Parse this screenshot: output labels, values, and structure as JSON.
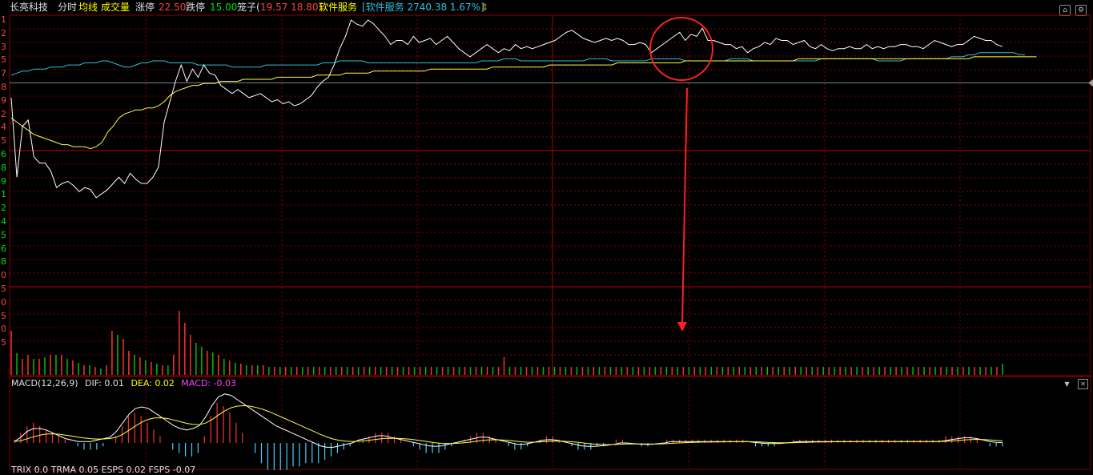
{
  "header": {
    "stock_name": "长亮科技",
    "tab_intraday": "分时",
    "avg_label": "均线",
    "volume_label": "成交量",
    "limit_up_label": "涨停",
    "limit_up": "22.50",
    "limit_down_label": "跌停",
    "limit_down": "15.00",
    "twin_label": "笼子(",
    "twin_values": "19.57 18.80)",
    "sector_label": "软件服务",
    "sector_index": "[软件服务 2740.38 1.67%]"
  },
  "left_axis": [
    "1",
    "2",
    "3",
    "5",
    "7",
    "8",
    "9",
    "2",
    "4",
    "5",
    "6",
    "8",
    "9",
    "1",
    "2",
    "4",
    "5",
    "6",
    "8",
    "0",
    "5",
    "0",
    "5",
    "0",
    "5"
  ],
  "macd": {
    "name": "MACD(12,26,9)",
    "dif": "DIF: 0.01",
    "dea": "DEA: 0.02",
    "macd": "MACD: -0.03"
  },
  "footer": "TRIX 0.0  TRMA 0.05  ESPS 0.02  FSPS -0.07",
  "colors": {
    "price": "#ffffff",
    "avg": "#ffff40",
    "index": "#30c0d0",
    "grid": "#8a0000",
    "volume_up": "#ff3030",
    "volume_down": "#00c000",
    "macd_down": "#40d0ff",
    "annotation": "#ff2020"
  },
  "chart_data": {
    "type": "line",
    "price": [
      0.62,
      0.23,
      0.48,
      0.51,
      0.33,
      0.3,
      0.3,
      0.26,
      0.18,
      0.2,
      0.21,
      0.19,
      0.16,
      0.18,
      0.17,
      0.13,
      0.15,
      0.17,
      0.2,
      0.23,
      0.2,
      0.25,
      0.22,
      0.2,
      0.2,
      0.23,
      0.28,
      0.5,
      0.6,
      0.7,
      0.78,
      0.7,
      0.76,
      0.72,
      0.78,
      0.74,
      0.73,
      0.68,
      0.66,
      0.64,
      0.66,
      0.64,
      0.62,
      0.63,
      0.64,
      0.62,
      0.6,
      0.61,
      0.59,
      0.6,
      0.58,
      0.59,
      0.61,
      0.63,
      0.67,
      0.7,
      0.72,
      0.78,
      0.86,
      0.92,
      1.0,
      0.98,
      0.97,
      1.0,
      0.98,
      0.95,
      0.92,
      0.88,
      0.9,
      0.9,
      0.88,
      0.92,
      0.89,
      0.9,
      0.91,
      0.88,
      0.9,
      0.92,
      0.89,
      0.86,
      0.84,
      0.82,
      0.84,
      0.86,
      0.88,
      0.86,
      0.84,
      0.86,
      0.85,
      0.88,
      0.86,
      0.87,
      0.86,
      0.87,
      0.88,
      0.89,
      0.9,
      0.92,
      0.94,
      0.95,
      0.93,
      0.91,
      0.9,
      0.89,
      0.9,
      0.91,
      0.9,
      0.91,
      0.9,
      0.88,
      0.88,
      0.89,
      0.88,
      0.84,
      0.86,
      0.88,
      0.9,
      0.92,
      0.94,
      0.9,
      0.93,
      0.92,
      0.96,
      0.9,
      0.9,
      0.89,
      0.88,
      0.88,
      0.86,
      0.87,
      0.84,
      0.86,
      0.87,
      0.89,
      0.88,
      0.91,
      0.9,
      0.9,
      0.88,
      0.89,
      0.9,
      0.87,
      0.86,
      0.88,
      0.86,
      0.85,
      0.86,
      0.86,
      0.87,
      0.86,
      0.86,
      0.88,
      0.86,
      0.87,
      0.86,
      0.87,
      0.87,
      0.88,
      0.88,
      0.87,
      0.87,
      0.86,
      0.88,
      0.9,
      0.89,
      0.88,
      0.87,
      0.88,
      0.88,
      0.9,
      0.92,
      0.91,
      0.9,
      0.9,
      0.88,
      0.87
    ],
    "avg": [
      0.52,
      0.5,
      0.48,
      0.46,
      0.44,
      0.43,
      0.42,
      0.41,
      0.4,
      0.39,
      0.39,
      0.38,
      0.38,
      0.38,
      0.37,
      0.38,
      0.4,
      0.45,
      0.48,
      0.52,
      0.54,
      0.55,
      0.56,
      0.56,
      0.57,
      0.57,
      0.58,
      0.6,
      0.63,
      0.65,
      0.66,
      0.67,
      0.68,
      0.68,
      0.69,
      0.69,
      0.69,
      0.7,
      0.7,
      0.7,
      0.7,
      0.71,
      0.71,
      0.71,
      0.71,
      0.71,
      0.71,
      0.72,
      0.72,
      0.72,
      0.72,
      0.72,
      0.72,
      0.72,
      0.73,
      0.73,
      0.73,
      0.73,
      0.73,
      0.74,
      0.74,
      0.74,
      0.74,
      0.74,
      0.75,
      0.75,
      0.75,
      0.75,
      0.75,
      0.75,
      0.75,
      0.75,
      0.75,
      0.75,
      0.76,
      0.76,
      0.76,
      0.76,
      0.76,
      0.76,
      0.76,
      0.76,
      0.76,
      0.76,
      0.76,
      0.77,
      0.77,
      0.77,
      0.77,
      0.77,
      0.77,
      0.77,
      0.77,
      0.77,
      0.77,
      0.78,
      0.78,
      0.78,
      0.78,
      0.78,
      0.78,
      0.78,
      0.78,
      0.78,
      0.78,
      0.78,
      0.78,
      0.79,
      0.79,
      0.79,
      0.79,
      0.79,
      0.79,
      0.79,
      0.79,
      0.79,
      0.79,
      0.79,
      0.79,
      0.8,
      0.8,
      0.8,
      0.8,
      0.8,
      0.8,
      0.8,
      0.8,
      0.8,
      0.8,
      0.8,
      0.8,
      0.8,
      0.8,
      0.8,
      0.8,
      0.8,
      0.8,
      0.8,
      0.8,
      0.81,
      0.81,
      0.81,
      0.81,
      0.81,
      0.81,
      0.81,
      0.81,
      0.81,
      0.81,
      0.81,
      0.81,
      0.81,
      0.81,
      0.81,
      0.81,
      0.81,
      0.81,
      0.81,
      0.81,
      0.81,
      0.81,
      0.81,
      0.81,
      0.81,
      0.81,
      0.81,
      0.81,
      0.81,
      0.81,
      0.81,
      0.82,
      0.82,
      0.82,
      0.82,
      0.82,
      0.82,
      0.82,
      0.82,
      0.82,
      0.82,
      0.82,
      0.82
    ],
    "index": [
      0.73,
      0.74,
      0.75,
      0.75,
      0.76,
      0.76,
      0.76,
      0.77,
      0.77,
      0.77,
      0.78,
      0.78,
      0.78,
      0.79,
      0.79,
      0.79,
      0.8,
      0.8,
      0.79,
      0.78,
      0.77,
      0.77,
      0.78,
      0.79,
      0.79,
      0.8,
      0.8,
      0.8,
      0.79,
      0.79,
      0.79,
      0.79,
      0.79,
      0.78,
      0.78,
      0.78,
      0.78,
      0.78,
      0.78,
      0.77,
      0.77,
      0.77,
      0.77,
      0.77,
      0.77,
      0.78,
      0.78,
      0.78,
      0.78,
      0.78,
      0.78,
      0.78,
      0.78,
      0.78,
      0.78,
      0.79,
      0.79,
      0.79,
      0.8,
      0.8,
      0.8,
      0.8,
      0.8,
      0.79,
      0.79,
      0.79,
      0.79,
      0.79,
      0.79,
      0.79,
      0.79,
      0.79,
      0.79,
      0.79,
      0.79,
      0.79,
      0.79,
      0.79,
      0.79,
      0.79,
      0.79,
      0.79,
      0.79,
      0.8,
      0.8,
      0.8,
      0.8,
      0.81,
      0.81,
      0.81,
      0.8,
      0.8,
      0.8,
      0.8,
      0.8,
      0.8,
      0.8,
      0.8,
      0.8,
      0.8,
      0.8,
      0.8,
      0.81,
      0.81,
      0.81,
      0.81,
      0.8,
      0.8,
      0.8,
      0.8,
      0.8,
      0.8,
      0.8,
      0.81,
      0.81,
      0.81,
      0.81,
      0.81,
      0.81,
      0.8,
      0.8,
      0.8,
      0.8,
      0.8,
      0.8,
      0.8,
      0.8,
      0.81,
      0.81,
      0.81,
      0.81,
      0.8,
      0.8,
      0.8,
      0.8,
      0.8,
      0.8,
      0.8,
      0.8,
      0.8,
      0.8,
      0.8,
      0.8,
      0.81,
      0.81,
      0.81,
      0.81,
      0.81,
      0.81,
      0.81,
      0.81,
      0.81,
      0.81,
      0.8,
      0.8,
      0.8,
      0.8,
      0.8,
      0.81,
      0.81,
      0.81,
      0.81,
      0.81,
      0.81,
      0.81,
      0.81,
      0.82,
      0.82,
      0.82,
      0.83,
      0.83,
      0.84,
      0.84,
      0.84,
      0.84,
      0.84,
      0.84,
      0.84,
      0.83,
      0.83
    ],
    "volume": [
      0.55,
      0.27,
      0.2,
      0.25,
      0.2,
      0.2,
      0.22,
      0.25,
      0.25,
      0.25,
      0.2,
      0.18,
      0.15,
      0.12,
      0.12,
      0.1,
      0.08,
      0.12,
      0.55,
      0.5,
      0.45,
      0.3,
      0.25,
      0.22,
      0.18,
      0.16,
      0.14,
      0.12,
      0.12,
      0.25,
      0.8,
      0.65,
      0.5,
      0.4,
      0.35,
      0.3,
      0.28,
      0.25,
      0.2,
      0.18,
      0.15,
      0.14,
      0.12,
      0.12,
      0.12,
      0.12,
      0.1,
      0.1,
      0.1,
      0.1,
      0.1,
      0.1,
      0.1,
      0.1,
      0.1,
      0.1,
      0.1,
      0.1,
      0.1,
      0.1,
      0.1,
      0.1,
      0.1,
      0.1,
      0.1,
      0.1,
      0.1,
      0.1,
      0.1,
      0.1,
      0.1,
      0.1,
      0.1,
      0.1,
      0.1,
      0.1,
      0.1,
      0.1,
      0.1,
      0.1,
      0.1,
      0.1,
      0.1,
      0.1,
      0.1,
      0.1,
      0.1,
      0.1,
      0.22,
      0.1,
      0.1,
      0.1,
      0.1,
      0.1,
      0.1,
      0.1,
      0.1,
      0.1,
      0.1,
      0.1,
      0.1,
      0.1,
      0.1,
      0.1,
      0.1,
      0.1,
      0.1,
      0.1,
      0.1,
      0.1,
      0.1,
      0.1,
      0.1,
      0.1,
      0.1,
      0.1,
      0.1,
      0.1,
      0.1,
      0.1,
      0.1,
      0.1,
      0.1,
      0.1,
      0.1,
      0.1,
      0.1,
      0.1,
      0.1,
      0.1,
      0.1,
      0.1,
      0.1,
      0.1,
      0.1,
      0.1,
      0.1,
      0.1,
      0.1,
      0.1,
      0.1,
      0.1,
      0.1,
      0.1,
      0.1,
      0.1,
      0.1,
      0.1,
      0.1,
      0.1,
      0.1,
      0.1,
      0.1,
      0.1,
      0.1,
      0.1,
      0.1,
      0.1,
      0.1,
      0.1,
      0.1,
      0.1,
      0.1,
      0.1,
      0.1,
      0.1,
      0.1,
      0.1,
      0.1,
      0.1,
      0.1,
      0.1,
      0.1,
      0.1,
      0.1,
      0.1,
      0.1,
      0.14
    ],
    "volume_up": [
      1,
      0,
      1,
      1,
      0,
      1,
      0,
      1,
      0,
      1,
      0,
      1,
      0,
      1,
      0,
      1,
      0,
      1,
      1,
      0,
      1,
      1,
      0,
      1,
      0,
      1,
      0,
      1,
      0,
      1,
      1,
      1,
      1,
      0,
      0,
      1,
      0,
      1,
      0,
      1,
      0,
      1,
      0,
      1,
      0,
      1,
      0,
      1,
      0,
      1,
      0,
      1,
      0,
      1,
      0,
      1,
      0,
      1,
      0,
      1,
      0,
      1,
      0,
      1,
      0,
      1,
      0,
      1,
      0,
      1,
      0,
      1,
      0,
      1,
      0,
      1,
      0,
      1,
      0,
      1,
      0,
      1,
      0,
      1,
      0,
      1,
      0,
      1,
      1,
      0,
      1,
      0,
      1,
      0,
      1,
      0,
      1,
      0,
      1,
      0,
      1,
      0,
      1,
      0,
      1,
      0,
      1,
      0,
      1,
      0,
      1,
      0,
      1,
      0,
      1,
      0,
      1,
      0,
      1,
      0,
      1,
      0,
      1,
      0,
      1,
      0,
      1,
      0,
      1,
      0,
      1,
      0,
      1,
      0,
      1,
      0,
      1,
      0,
      1,
      0,
      1,
      0,
      1,
      0,
      1,
      0,
      1,
      0,
      1,
      0,
      1,
      0,
      1,
      0,
      1,
      0,
      1,
      0,
      1,
      0,
      1,
      0,
      1,
      0,
      1,
      0,
      1,
      0,
      1,
      0,
      1,
      0,
      1,
      0,
      1,
      0,
      1,
      0,
      1,
      0
    ],
    "macd_hist": [
      0.1,
      0.3,
      0.5,
      0.6,
      0.5,
      0.4,
      0.3,
      0.2,
      0.1,
      0.0,
      -0.1,
      -0.2,
      -0.2,
      -0.2,
      -0.1,
      0.0,
      0.2,
      0.5,
      0.8,
      0.9,
      0.8,
      0.6,
      0.4,
      0.2,
      0.0,
      -0.2,
      -0.3,
      -0.4,
      -0.4,
      -0.3,
      0.2,
      0.8,
      1.2,
      1.1,
      0.9,
      0.6,
      0.3,
      0.0,
      -0.3,
      -0.6,
      -0.8,
      -0.9,
      -0.9,
      -0.8,
      -0.7,
      -0.7,
      -0.6,
      -0.6,
      -0.6,
      -0.5,
      -0.4,
      -0.3,
      -0.2,
      -0.1,
      0.0,
      0.1,
      0.2,
      0.3,
      0.3,
      0.3,
      0.2,
      0.1,
      0.0,
      -0.1,
      -0.2,
      -0.3,
      -0.3,
      -0.3,
      -0.2,
      -0.1,
      0.0,
      0.1,
      0.2,
      0.3,
      0.3,
      0.2,
      0.1,
      0.0,
      -0.1,
      -0.2,
      -0.2,
      -0.1,
      0.0,
      0.1,
      0.2,
      0.2,
      0.1,
      0.0,
      -0.1,
      -0.2,
      -0.2,
      -0.2,
      -0.1,
      -0.1,
      0.0,
      0.1,
      0.1,
      0.0,
      0.0,
      -0.1,
      -0.1,
      0.0,
      0.0,
      0.1,
      0.1,
      0.1,
      0.1,
      0.1,
      0.1,
      0.1,
      0.1,
      0.1,
      0.1,
      0.1,
      0.1,
      0.1,
      0.0,
      -0.1,
      -0.1,
      -0.1,
      -0.1,
      0.0,
      0.0,
      0.1,
      0.1,
      0.1,
      0.1,
      0.1,
      0.1,
      0.1,
      0.1,
      0.1,
      0.1,
      0.1,
      0.1,
      0.1,
      0.1,
      0.1,
      0.1,
      0.1,
      0.1,
      0.1,
      0.1,
      0.1,
      0.1,
      0.1,
      0.1,
      0.2,
      0.2,
      0.2,
      0.2,
      0.2,
      0.1,
      0.0,
      -0.1,
      -0.1,
      -0.1
    ],
    "dif": [
      0.05,
      0.2,
      0.4,
      0.5,
      0.5,
      0.45,
      0.35,
      0.25,
      0.15,
      0.1,
      0.05,
      0.05,
      0.05,
      0.1,
      0.15,
      0.2,
      0.4,
      0.7,
      1.0,
      1.2,
      1.25,
      1.2,
      1.05,
      0.9,
      0.75,
      0.6,
      0.5,
      0.45,
      0.5,
      0.6,
      0.9,
      1.3,
      1.6,
      1.7,
      1.65,
      1.5,
      1.35,
      1.2,
      1.05,
      0.9,
      0.75,
      0.6,
      0.5,
      0.4,
      0.3,
      0.2,
      0.1,
      0.0,
      -0.1,
      -0.15,
      -0.15,
      -0.1,
      -0.05,
      0.0,
      0.1,
      0.15,
      0.2,
      0.25,
      0.25,
      0.2,
      0.15,
      0.1,
      0.05,
      0.0,
      -0.05,
      -0.1,
      -0.12,
      -0.1,
      -0.05,
      0.0,
      0.05,
      0.1,
      0.15,
      0.2,
      0.2,
      0.15,
      0.1,
      0.05,
      0.0,
      -0.05,
      -0.05,
      0.0,
      0.05,
      0.1,
      0.12,
      0.1,
      0.05,
      0.0,
      -0.05,
      -0.1,
      -0.12,
      -0.12,
      -0.1,
      -0.08,
      -0.05,
      0.0,
      0.0,
      -0.02,
      -0.04,
      -0.05,
      -0.05,
      -0.02,
      0.0,
      0.05,
      0.05,
      0.05,
      0.05,
      0.05,
      0.05,
      0.05,
      0.05,
      0.05,
      0.05,
      0.05,
      0.05,
      0.05,
      0.02,
      0.0,
      -0.02,
      -0.02,
      -0.02,
      0.0,
      0.02,
      0.05,
      0.05,
      0.05,
      0.05,
      0.05,
      0.05,
      0.05,
      0.05,
      0.05,
      0.05,
      0.05,
      0.05,
      0.05,
      0.05,
      0.05,
      0.05,
      0.05,
      0.05,
      0.05,
      0.05,
      0.05,
      0.05,
      0.05,
      0.08,
      0.12,
      0.15,
      0.18,
      0.18,
      0.15,
      0.1,
      0.05,
      0.02,
      0.01
    ]
  }
}
